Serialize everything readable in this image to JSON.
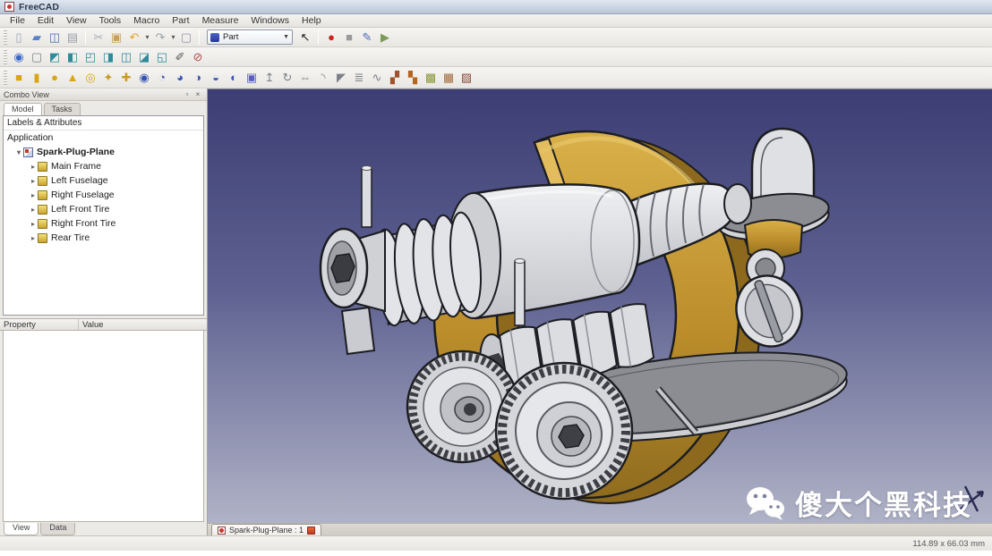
{
  "window": {
    "title": "FreeCAD"
  },
  "menu_bar": {
    "items": [
      {
        "name": "menu-file",
        "label": "File"
      },
      {
        "name": "menu-edit",
        "label": "Edit"
      },
      {
        "name": "menu-view",
        "label": "View"
      },
      {
        "name": "menu-tools",
        "label": "Tools"
      },
      {
        "name": "menu-macro",
        "label": "Macro"
      },
      {
        "name": "menu-part",
        "label": "Part"
      },
      {
        "name": "menu-measure",
        "label": "Measure"
      },
      {
        "name": "menu-windows",
        "label": "Windows"
      },
      {
        "name": "menu-help",
        "label": "Help"
      }
    ]
  },
  "toolbars": {
    "standard_left": [
      {
        "name": "new-file-icon",
        "glyph": "▯",
        "color": "#9aa4b4"
      },
      {
        "name": "open-file-icon",
        "glyph": "▰",
        "color": "#5b82c8"
      },
      {
        "name": "save-icon",
        "glyph": "◫",
        "color": "#4a6fb5"
      },
      {
        "name": "print-icon",
        "glyph": "▤",
        "color": "#9aa0a8"
      }
    ],
    "edit_group": [
      {
        "name": "cut-icon",
        "glyph": "✂",
        "color": "#a8adb5"
      },
      {
        "name": "paste-icon",
        "glyph": "▣",
        "color": "#c9a05a"
      },
      {
        "name": "undo-icon",
        "glyph": "↶",
        "color": "#e0a42a"
      },
      {
        "name": "undo-menu-caret",
        "glyph": "▾",
        "color": "#555",
        "cls": "caret"
      },
      {
        "name": "redo-icon",
        "glyph": "↷",
        "color": "#9aa0a8"
      },
      {
        "name": "redo-menu-caret",
        "glyph": "▾",
        "color": "#555",
        "cls": "caret"
      },
      {
        "name": "refresh-icon",
        "glyph": "▢",
        "color": "#8f94a8"
      }
    ],
    "workbench_selector": {
      "value": "Part"
    },
    "help_group": [
      {
        "name": "whats-this-icon",
        "glyph": "↖",
        "color": "#222"
      }
    ],
    "macro_group": [
      {
        "name": "record-macro-icon",
        "glyph": "●",
        "color": "#cc2222"
      },
      {
        "name": "stop-macro-icon",
        "glyph": "■",
        "color": "#9a9a9a"
      },
      {
        "name": "edit-macro-icon",
        "glyph": "✎",
        "color": "#4a6fb5"
      },
      {
        "name": "run-macro-icon",
        "glyph": "▶",
        "color": "#7a9a55"
      }
    ],
    "view_toolbar": [
      {
        "name": "fit-all-icon",
        "glyph": "◉",
        "color": "#3a66c4"
      },
      {
        "name": "draw-style-icon",
        "glyph": "▢",
        "color": "#7c8088"
      },
      {
        "name": "view-axonometric-icon",
        "glyph": "◩",
        "color": "#2e8b9a"
      },
      {
        "name": "view-front-icon",
        "glyph": "◧",
        "color": "#2e8b9a"
      },
      {
        "name": "view-top-icon",
        "glyph": "◰",
        "color": "#2e8b9a"
      },
      {
        "name": "view-right-icon",
        "glyph": "◨",
        "color": "#2e8b9a"
      },
      {
        "name": "view-rear-icon",
        "glyph": "◫",
        "color": "#2e8b9a"
      },
      {
        "name": "view-bottom-icon",
        "glyph": "◪",
        "color": "#2e8b9a"
      },
      {
        "name": "view-left-icon",
        "glyph": "◱",
        "color": "#2e8b9a"
      },
      {
        "name": "measure-distance-icon",
        "glyph": "✐",
        "color": "#555"
      },
      {
        "name": "clear-measurement-icon",
        "glyph": "⊘",
        "color": "#b04a4a"
      }
    ],
    "part_toolbar": [
      {
        "name": "part-box-icon",
        "glyph": "■",
        "color": "#d8a713"
      },
      {
        "name": "part-cylinder-icon",
        "glyph": "▮",
        "color": "#d8a713"
      },
      {
        "name": "part-sphere-icon",
        "glyph": "●",
        "color": "#d8a713"
      },
      {
        "name": "part-cone-icon",
        "glyph": "▲",
        "color": "#d8a713"
      },
      {
        "name": "part-torus-icon",
        "glyph": "◎",
        "color": "#d8a713"
      },
      {
        "name": "part-primitives-icon",
        "glyph": "✦",
        "color": "#c89a2a"
      },
      {
        "name": "shape-builder-icon",
        "glyph": "✚",
        "color": "#c89a2a"
      },
      {
        "name": "boolean-union-icon",
        "glyph": "◉",
        "color": "#3854b0"
      },
      {
        "name": "boolean-cut-icon",
        "glyph": "◔",
        "color": "#3854b0"
      },
      {
        "name": "boolean-intersection-icon",
        "glyph": "◕",
        "color": "#3854b0"
      },
      {
        "name": "boolean-connect-icon",
        "glyph": "◑",
        "color": "#3854b0"
      },
      {
        "name": "boolean-embed-icon",
        "glyph": "◒",
        "color": "#3854b0"
      },
      {
        "name": "boolean-slice-icon",
        "glyph": "◐",
        "color": "#3854b0"
      },
      {
        "name": "boolean-operation-icon",
        "glyph": "▣",
        "color": "#5b5fc0"
      },
      {
        "name": "extrude-icon",
        "glyph": "↥",
        "color": "#7c8088"
      },
      {
        "name": "revolve-icon",
        "glyph": "↻",
        "color": "#7c8088"
      },
      {
        "name": "mirror-icon",
        "glyph": "⇔",
        "color": "#7c8088"
      },
      {
        "name": "fillet-icon",
        "glyph": "◝",
        "color": "#7c8088"
      },
      {
        "name": "chamfer-icon",
        "glyph": "◤",
        "color": "#7c8088"
      },
      {
        "name": "loft-icon",
        "glyph": "≣",
        "color": "#7c8088"
      },
      {
        "name": "sweep-icon",
        "glyph": "∿",
        "color": "#7c8088"
      },
      {
        "name": "section-icon",
        "glyph": "▞",
        "color": "#a0522d"
      },
      {
        "name": "cross-sections-icon",
        "glyph": "▚",
        "color": "#b5651d"
      },
      {
        "name": "offset-icon",
        "glyph": "▩",
        "color": "#8a9a3a"
      },
      {
        "name": "thickness-icon",
        "glyph": "▦",
        "color": "#a26a3a"
      },
      {
        "name": "convert-shape-icon",
        "glyph": "▨",
        "color": "#8a4a3a"
      }
    ]
  },
  "combo_view": {
    "title": "Combo View",
    "window_buttons": [
      {
        "name": "dock-float-button",
        "glyph": "▫"
      },
      {
        "name": "dock-close-button",
        "glyph": "×"
      }
    ],
    "tabs": [
      {
        "name": "tab-model",
        "label": "Model",
        "active": true
      },
      {
        "name": "tab-tasks",
        "label": "Tasks"
      }
    ],
    "tree_header": "Labels & Attributes",
    "tree": {
      "root_label": "Application",
      "document": {
        "label": "Spark-Plug-Plane",
        "expand_glyph": "▾"
      },
      "items": [
        {
          "name": "tree-item-main-frame",
          "label": "Main Frame",
          "glyph": "▸"
        },
        {
          "name": "tree-item-left-fuselage",
          "label": "Left Fuselage",
          "glyph": "▸"
        },
        {
          "name": "tree-item-right-fuselage",
          "label": "Right Fuselage",
          "glyph": "▸"
        },
        {
          "name": "tree-item-left-front-tire",
          "label": "Left Front Tire",
          "glyph": "▸"
        },
        {
          "name": "tree-item-right-front-tire",
          "label": "Right Front Tire",
          "glyph": "▸"
        },
        {
          "name": "tree-item-rear-tire",
          "label": "Rear Tire",
          "glyph": "▸"
        }
      ]
    },
    "property_panel": {
      "col_property": "Property",
      "col_value": "Value"
    },
    "bottom_tabs": [
      {
        "name": "tab-view",
        "label": "View",
        "active": true
      },
      {
        "name": "tab-data",
        "label": "Data"
      }
    ]
  },
  "viewport": {
    "document_tab": {
      "label": "Spark-Plug-Plane : 1"
    },
    "watermark": {
      "text": "傻大个黑科技",
      "icon": "wechat-icon"
    },
    "colors": {
      "bg-top": "#3c3e74",
      "bg-bottom": "#b0b3c6",
      "model-gray": "#d8d9dd",
      "model-gold": "#c3932b",
      "outline": "#1c1d22"
    }
  },
  "status_bar": {
    "dimensions": "114.89 x 66.03 mm"
  }
}
